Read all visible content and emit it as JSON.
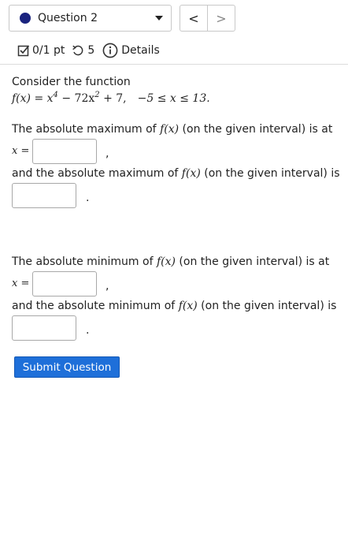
{
  "header": {
    "question_label": "Question 2",
    "prev_glyph": "<",
    "next_glyph": ">"
  },
  "meta": {
    "score": "0/1 pt",
    "attempts": "5",
    "details": "Details"
  },
  "question": {
    "intro": "Consider the function",
    "function_lhs": "f(x) = x",
    "exp_4": "4",
    "function_mid": " − 72x",
    "exp_2": "2",
    "function_rhs": " + 7,",
    "interval": "−5 ≤ x ≤ 13.",
    "abs_max_at_text_pre": "The absolute maximum of ",
    "abs_max_at_text_post": " (on the given interval) is at",
    "abs_max_value_text_pre": "and the absolute maximum of ",
    "abs_max_value_text_post": " (on the given interval) is",
    "abs_min_at_text_pre": "The absolute minimum of ",
    "abs_min_at_text_post": " (on the given interval) is at",
    "abs_min_value_text_pre": "and the absolute minimum of ",
    "abs_min_value_text_post": " (on the given interval) is",
    "fx": "f(x)",
    "x_eq": "x =",
    "comma": ",",
    "period": "."
  },
  "inputs": {
    "max_x": "",
    "max_value": "",
    "min_x": "",
    "min_value": ""
  },
  "submit_label": "Submit Question",
  "colors": {
    "accent": "#1e6fd9",
    "question_dot": "#1a237e"
  }
}
